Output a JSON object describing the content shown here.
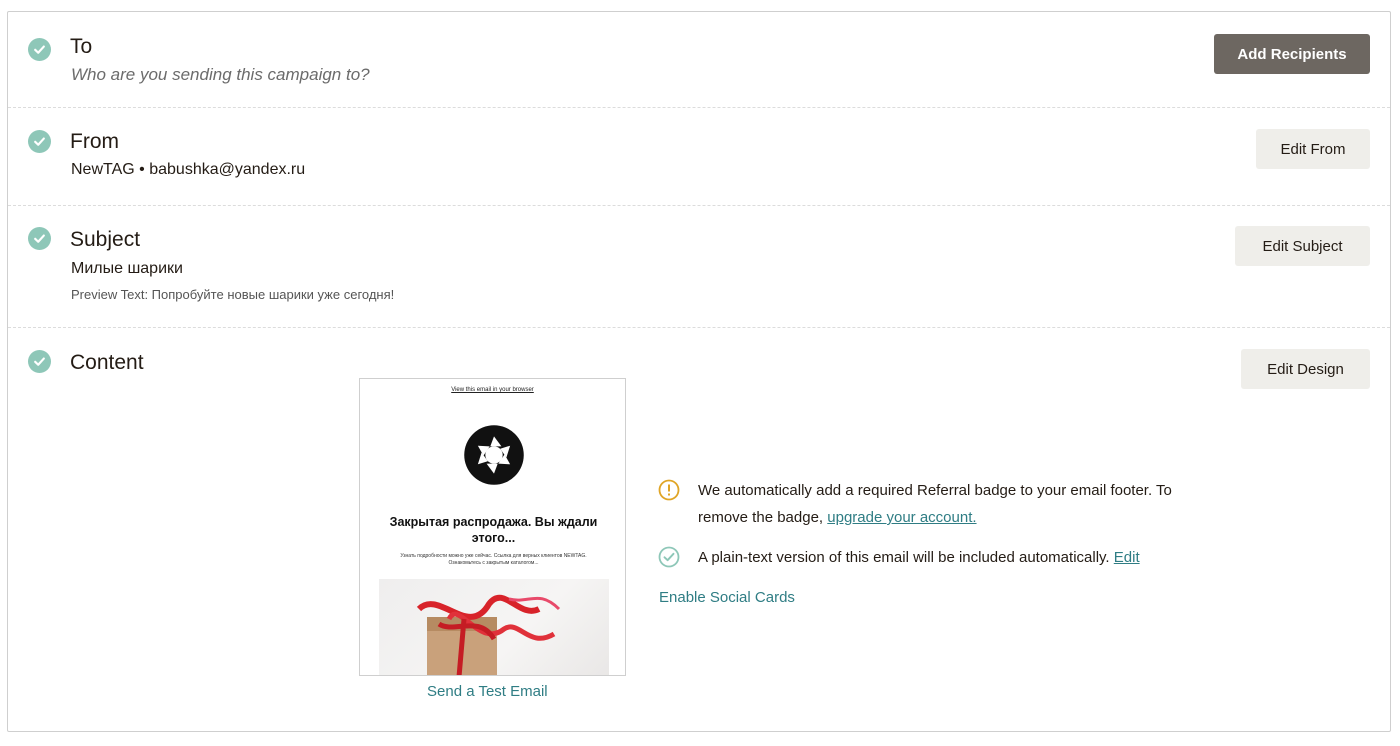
{
  "to": {
    "title": "To",
    "subtitle": "Who are you sending this campaign to?",
    "button": "Add Recipients"
  },
  "from": {
    "title": "From",
    "name": "NewTAG",
    "separator": "•",
    "email": "babushka@yandex.ru",
    "button": "Edit From"
  },
  "subject": {
    "title": "Subject",
    "value": "Милые шарики",
    "preview_text": "Preview Text: Попробуйте новые шарики уже сегодня!",
    "button": "Edit Subject"
  },
  "content": {
    "title": "Content",
    "button": "Edit Design",
    "preview": {
      "browser_link": "View this email in your browser",
      "headline": "Закрытая распродажа. Вы ждали этого...",
      "body": "Узнать подробности можно уже сейчас. Ссылка для верных клиентов NEWTAG. Ознакомьтесь с закрытым каталогом..."
    },
    "send_test": "Send a Test Email",
    "referral_notice": "We automatically add a required Referral badge to your email footer. To remove the badge,",
    "referral_link": "upgrade your account.",
    "plaintext_notice": "A plain-text version of this email will be included automatically.",
    "plaintext_edit": "Edit",
    "social_cards": "Enable Social Cards"
  },
  "colors": {
    "check": "#8ec7b8",
    "dark_button": "#6d6761",
    "light_button": "#efeeea",
    "link": "#2f7d84",
    "warning": "#e0a526"
  }
}
